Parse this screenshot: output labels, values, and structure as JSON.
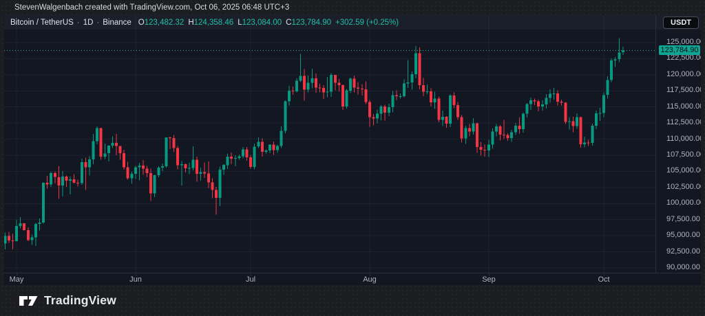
{
  "attribution": "StevenWalgenbach created with TradingView.com, Oct 06, 2025 06:48 UTC+3",
  "legend": {
    "symbol": "Bitcoin / TetherUS",
    "interval": "1D",
    "exchange": "Binance",
    "separator": "·",
    "ohlc": [
      {
        "label": "O",
        "value": "123,482.32"
      },
      {
        "label": "H",
        "value": "124,358.46"
      },
      {
        "label": "L",
        "value": "123,084.00"
      },
      {
        "label": "C",
        "value": "123,784.90"
      }
    ],
    "change": "+302.59",
    "change_pct": "(+0.25%)"
  },
  "currency_button": "USDT",
  "footer": {
    "brand": "TradingView"
  },
  "colors": {
    "up": "#089981",
    "down": "#f23645",
    "accent": "#23bfa8",
    "grid": "#1e222d",
    "axis_text": "#b2b5be",
    "badge_bg": "#0fa594",
    "background": "#131722"
  },
  "chart_data": {
    "type": "candlestick",
    "title": "Bitcoin / TetherUS · 1D · Binance",
    "timeframe": "1D",
    "start_date": "2025-04-28",
    "end_date": "2025-10-06",
    "ylim": [
      90000,
      125000
    ],
    "y_ticks": [
      90000,
      92500,
      95000,
      97500,
      100000,
      102500,
      105000,
      107500,
      110000,
      112500,
      115000,
      117500,
      120000,
      122500,
      125000
    ],
    "x_ticks": [
      {
        "label": "May",
        "index": 3
      },
      {
        "label": "Jun",
        "index": 34
      },
      {
        "label": "Jul",
        "index": 64
      },
      {
        "label": "Aug",
        "index": 95
      },
      {
        "label": "Sep",
        "index": 126
      },
      {
        "label": "Oct",
        "index": 156
      }
    ],
    "last_price": 123784.9,
    "last_price_label": "123,784.90",
    "grid": true,
    "legend_position": "top-left",
    "candles": [
      [
        93780,
        95520,
        92880,
        94980
      ],
      [
        94980,
        95610,
        93900,
        94280
      ],
      [
        94280,
        95300,
        92900,
        94180
      ],
      [
        94180,
        97440,
        94130,
        96490
      ],
      [
        96490,
        97910,
        96110,
        96910
      ],
      [
        96910,
        96940,
        95790,
        95890
      ],
      [
        95890,
        96320,
        94170,
        94320
      ],
      [
        94320,
        95190,
        93570,
        94750
      ],
      [
        94750,
        96990,
        93400,
        96830
      ],
      [
        96830,
        97670,
        95820,
        97030
      ],
      [
        97030,
        103310,
        96880,
        103250
      ],
      [
        103250,
        104310,
        102350,
        102970
      ],
      [
        102970,
        104950,
        102600,
        104700
      ],
      [
        104700,
        105000,
        103110,
        104110
      ],
      [
        104110,
        105810,
        100750,
        102810
      ],
      [
        102810,
        105050,
        101110,
        104170
      ],
      [
        104170,
        104350,
        102610,
        103540
      ],
      [
        103540,
        104190,
        101430,
        103740
      ],
      [
        103740,
        104550,
        103130,
        103210
      ],
      [
        103210,
        103710,
        102620,
        103190
      ],
      [
        103190,
        106990,
        102900,
        106450
      ],
      [
        106450,
        107110,
        102130,
        105620
      ],
      [
        105620,
        107340,
        104330,
        106850
      ],
      [
        106850,
        110790,
        106100,
        109680
      ],
      [
        109680,
        111970,
        109190,
        111690
      ],
      [
        111690,
        111780,
        106820,
        107290
      ],
      [
        107290,
        109300,
        106900,
        107790
      ],
      [
        107790,
        109070,
        106520,
        108990
      ],
      [
        108990,
        110450,
        108620,
        109440
      ],
      [
        109440,
        110790,
        107520,
        108930
      ],
      [
        108930,
        108950,
        106810,
        107800
      ],
      [
        107800,
        108340,
        105280,
        105640
      ],
      [
        105640,
        106480,
        103710,
        103900
      ],
      [
        103900,
        104920,
        103060,
        104640
      ],
      [
        104640,
        105880,
        103830,
        105650
      ],
      [
        105650,
        106330,
        103630,
        105880
      ],
      [
        105880,
        106770,
        104440,
        105430
      ],
      [
        105430,
        105860,
        104070,
        104730
      ],
      [
        104730,
        105440,
        100420,
        101580
      ],
      [
        101580,
        104460,
        100980,
        104390
      ],
      [
        104390,
        105770,
        104060,
        105570
      ],
      [
        105570,
        106220,
        105060,
        105790
      ],
      [
        105790,
        110290,
        105560,
        110250
      ],
      [
        110250,
        110400,
        108470,
        110180
      ],
      [
        110180,
        110630,
        108060,
        108640
      ],
      [
        108640,
        108920,
        105290,
        105930
      ],
      [
        105930,
        106610,
        102820,
        106090
      ],
      [
        106090,
        106240,
        104850,
        105470
      ],
      [
        105470,
        106310,
        104590,
        105550
      ],
      [
        105550,
        108910,
        105160,
        106790
      ],
      [
        106790,
        107280,
        103370,
        104600
      ],
      [
        104600,
        105590,
        103570,
        104880
      ],
      [
        104880,
        106360,
        103990,
        104690
      ],
      [
        104690,
        106540,
        102390,
        103290
      ],
      [
        103290,
        103910,
        100850,
        102120
      ],
      [
        102120,
        102580,
        98270,
        100870
      ],
      [
        100870,
        105740,
        99590,
        105240
      ],
      [
        105240,
        106090,
        104450,
        105980
      ],
      [
        105980,
        107770,
        105360,
        107280
      ],
      [
        107280,
        107950,
        106130,
        106970
      ],
      [
        106970,
        107480,
        105770,
        107090
      ],
      [
        107090,
        107610,
        106780,
        107330
      ],
      [
        107330,
        108790,
        107000,
        108390
      ],
      [
        108390,
        108780,
        106640,
        107170
      ],
      [
        107170,
        107570,
        105400,
        105700
      ],
      [
        105700,
        109340,
        105330,
        108860
      ],
      [
        108860,
        110290,
        108640,
        109580
      ],
      [
        109580,
        110110,
        107300,
        108040
      ],
      [
        108040,
        108430,
        107760,
        108230
      ],
      [
        108230,
        109210,
        107800,
        109180
      ],
      [
        109180,
        109620,
        107560,
        108300
      ],
      [
        108300,
        109170,
        107870,
        108920
      ],
      [
        108920,
        111990,
        108610,
        111290
      ],
      [
        111290,
        116040,
        110910,
        115880
      ],
      [
        115880,
        118290,
        115230,
        117520
      ],
      [
        117520,
        118190,
        116880,
        117430
      ],
      [
        117430,
        119470,
        117250,
        119090
      ],
      [
        119090,
        123240,
        118870,
        119850
      ],
      [
        119850,
        120890,
        115990,
        117680
      ],
      [
        117680,
        119880,
        117270,
        118740
      ],
      [
        118740,
        120940,
        117890,
        119440
      ],
      [
        119440,
        120190,
        117200,
        118010
      ],
      [
        118010,
        118580,
        117290,
        117940
      ],
      [
        117940,
        118400,
        116270,
        117250
      ],
      [
        117250,
        119680,
        116530,
        117380
      ],
      [
        117380,
        120250,
        116570,
        119960
      ],
      [
        119960,
        119990,
        117570,
        118780
      ],
      [
        118780,
        119360,
        117450,
        118370
      ],
      [
        118370,
        118490,
        114540,
        115060
      ],
      [
        115060,
        117790,
        114780,
        117560
      ],
      [
        117560,
        119550,
        117160,
        119380
      ],
      [
        119380,
        119890,
        117260,
        118020
      ],
      [
        118020,
        118860,
        116970,
        117860
      ],
      [
        117860,
        118520,
        116810,
        117740
      ],
      [
        117740,
        118950,
        115460,
        115760
      ],
      [
        115760,
        116100,
        111920,
        113440
      ],
      [
        113440,
        113900,
        112160,
        113220
      ],
      [
        113220,
        114600,
        112480,
        113980
      ],
      [
        113980,
        115270,
        112960,
        115080
      ],
      [
        115080,
        115330,
        112880,
        114110
      ],
      [
        114110,
        115520,
        113590,
        114990
      ],
      [
        114990,
        117480,
        114170,
        116860
      ],
      [
        116860,
        117560,
        116090,
        116680
      ],
      [
        116680,
        117090,
        116280,
        116690
      ],
      [
        116690,
        119280,
        116450,
        118670
      ],
      [
        118670,
        122290,
        117960,
        118830
      ],
      [
        118830,
        120540,
        117680,
        120110
      ],
      [
        120110,
        124460,
        119460,
        123330
      ],
      [
        123330,
        124240,
        117760,
        118390
      ],
      [
        118390,
        119510,
        116660,
        117370
      ],
      [
        117370,
        118480,
        117020,
        117410
      ],
      [
        117410,
        117910,
        115060,
        115690
      ],
      [
        115690,
        117380,
        114720,
        116280
      ],
      [
        116280,
        116620,
        112620,
        112990
      ],
      [
        112990,
        114410,
        112050,
        113470
      ],
      [
        113470,
        113590,
        111790,
        112420
      ],
      [
        112420,
        117020,
        111870,
        116790
      ],
      [
        116790,
        117270,
        114820,
        115290
      ],
      [
        115290,
        115770,
        112980,
        113440
      ],
      [
        113440,
        113760,
        109480,
        110120
      ],
      [
        110120,
        112070,
        109260,
        111710
      ],
      [
        111710,
        112340,
        110460,
        111180
      ],
      [
        111180,
        113280,
        110680,
        112460
      ],
      [
        112460,
        112590,
        107880,
        108790
      ],
      [
        108790,
        109560,
        107430,
        108340
      ],
      [
        108340,
        109210,
        107270,
        108230
      ],
      [
        108230,
        109900,
        107240,
        109170
      ],
      [
        109170,
        111670,
        108530,
        111200
      ],
      [
        111200,
        112380,
        110430,
        111980
      ],
      [
        111980,
        112210,
        109770,
        110710
      ],
      [
        110710,
        112970,
        110060,
        110630
      ],
      [
        110630,
        110940,
        109760,
        110160
      ],
      [
        110160,
        111440,
        109560,
        111080
      ],
      [
        111080,
        112540,
        110660,
        112070
      ],
      [
        112070,
        113390,
        110850,
        111540
      ],
      [
        111540,
        114120,
        111010,
        113950
      ],
      [
        113950,
        115600,
        113360,
        115440
      ],
      [
        115440,
        116480,
        114530,
        116060
      ],
      [
        116060,
        116330,
        115270,
        115890
      ],
      [
        115890,
        116120,
        114310,
        115070
      ],
      [
        115070,
        116010,
        114450,
        115370
      ],
      [
        115370,
        116990,
        114760,
        116420
      ],
      [
        116420,
        117770,
        115670,
        117060
      ],
      [
        117060,
        117940,
        116150,
        117110
      ],
      [
        117110,
        117560,
        115260,
        115830
      ],
      [
        115830,
        116160,
        115210,
        115680
      ],
      [
        115680,
        115790,
        112330,
        112690
      ],
      [
        112690,
        113440,
        111480,
        112800
      ],
      [
        112800,
        113450,
        111090,
        112040
      ],
      [
        112040,
        113990,
        111630,
        113420
      ],
      [
        113420,
        113450,
        108660,
        109210
      ],
      [
        109210,
        110370,
        108710,
        109470
      ],
      [
        109470,
        109880,
        108940,
        109400
      ],
      [
        109400,
        112430,
        109010,
        112080
      ],
      [
        112080,
        114440,
        111560,
        114010
      ],
      [
        114010,
        114880,
        112830,
        114070
      ],
      [
        114070,
        117260,
        113360,
        116860
      ],
      [
        116860,
        119780,
        116320,
        119180
      ],
      [
        119180,
        122540,
        118870,
        122230
      ],
      [
        122230,
        122780,
        121190,
        122410
      ],
      [
        122410,
        125690,
        121970,
        123460
      ],
      [
        123482.32,
        124358.46,
        123084.0,
        123784.9
      ]
    ]
  }
}
